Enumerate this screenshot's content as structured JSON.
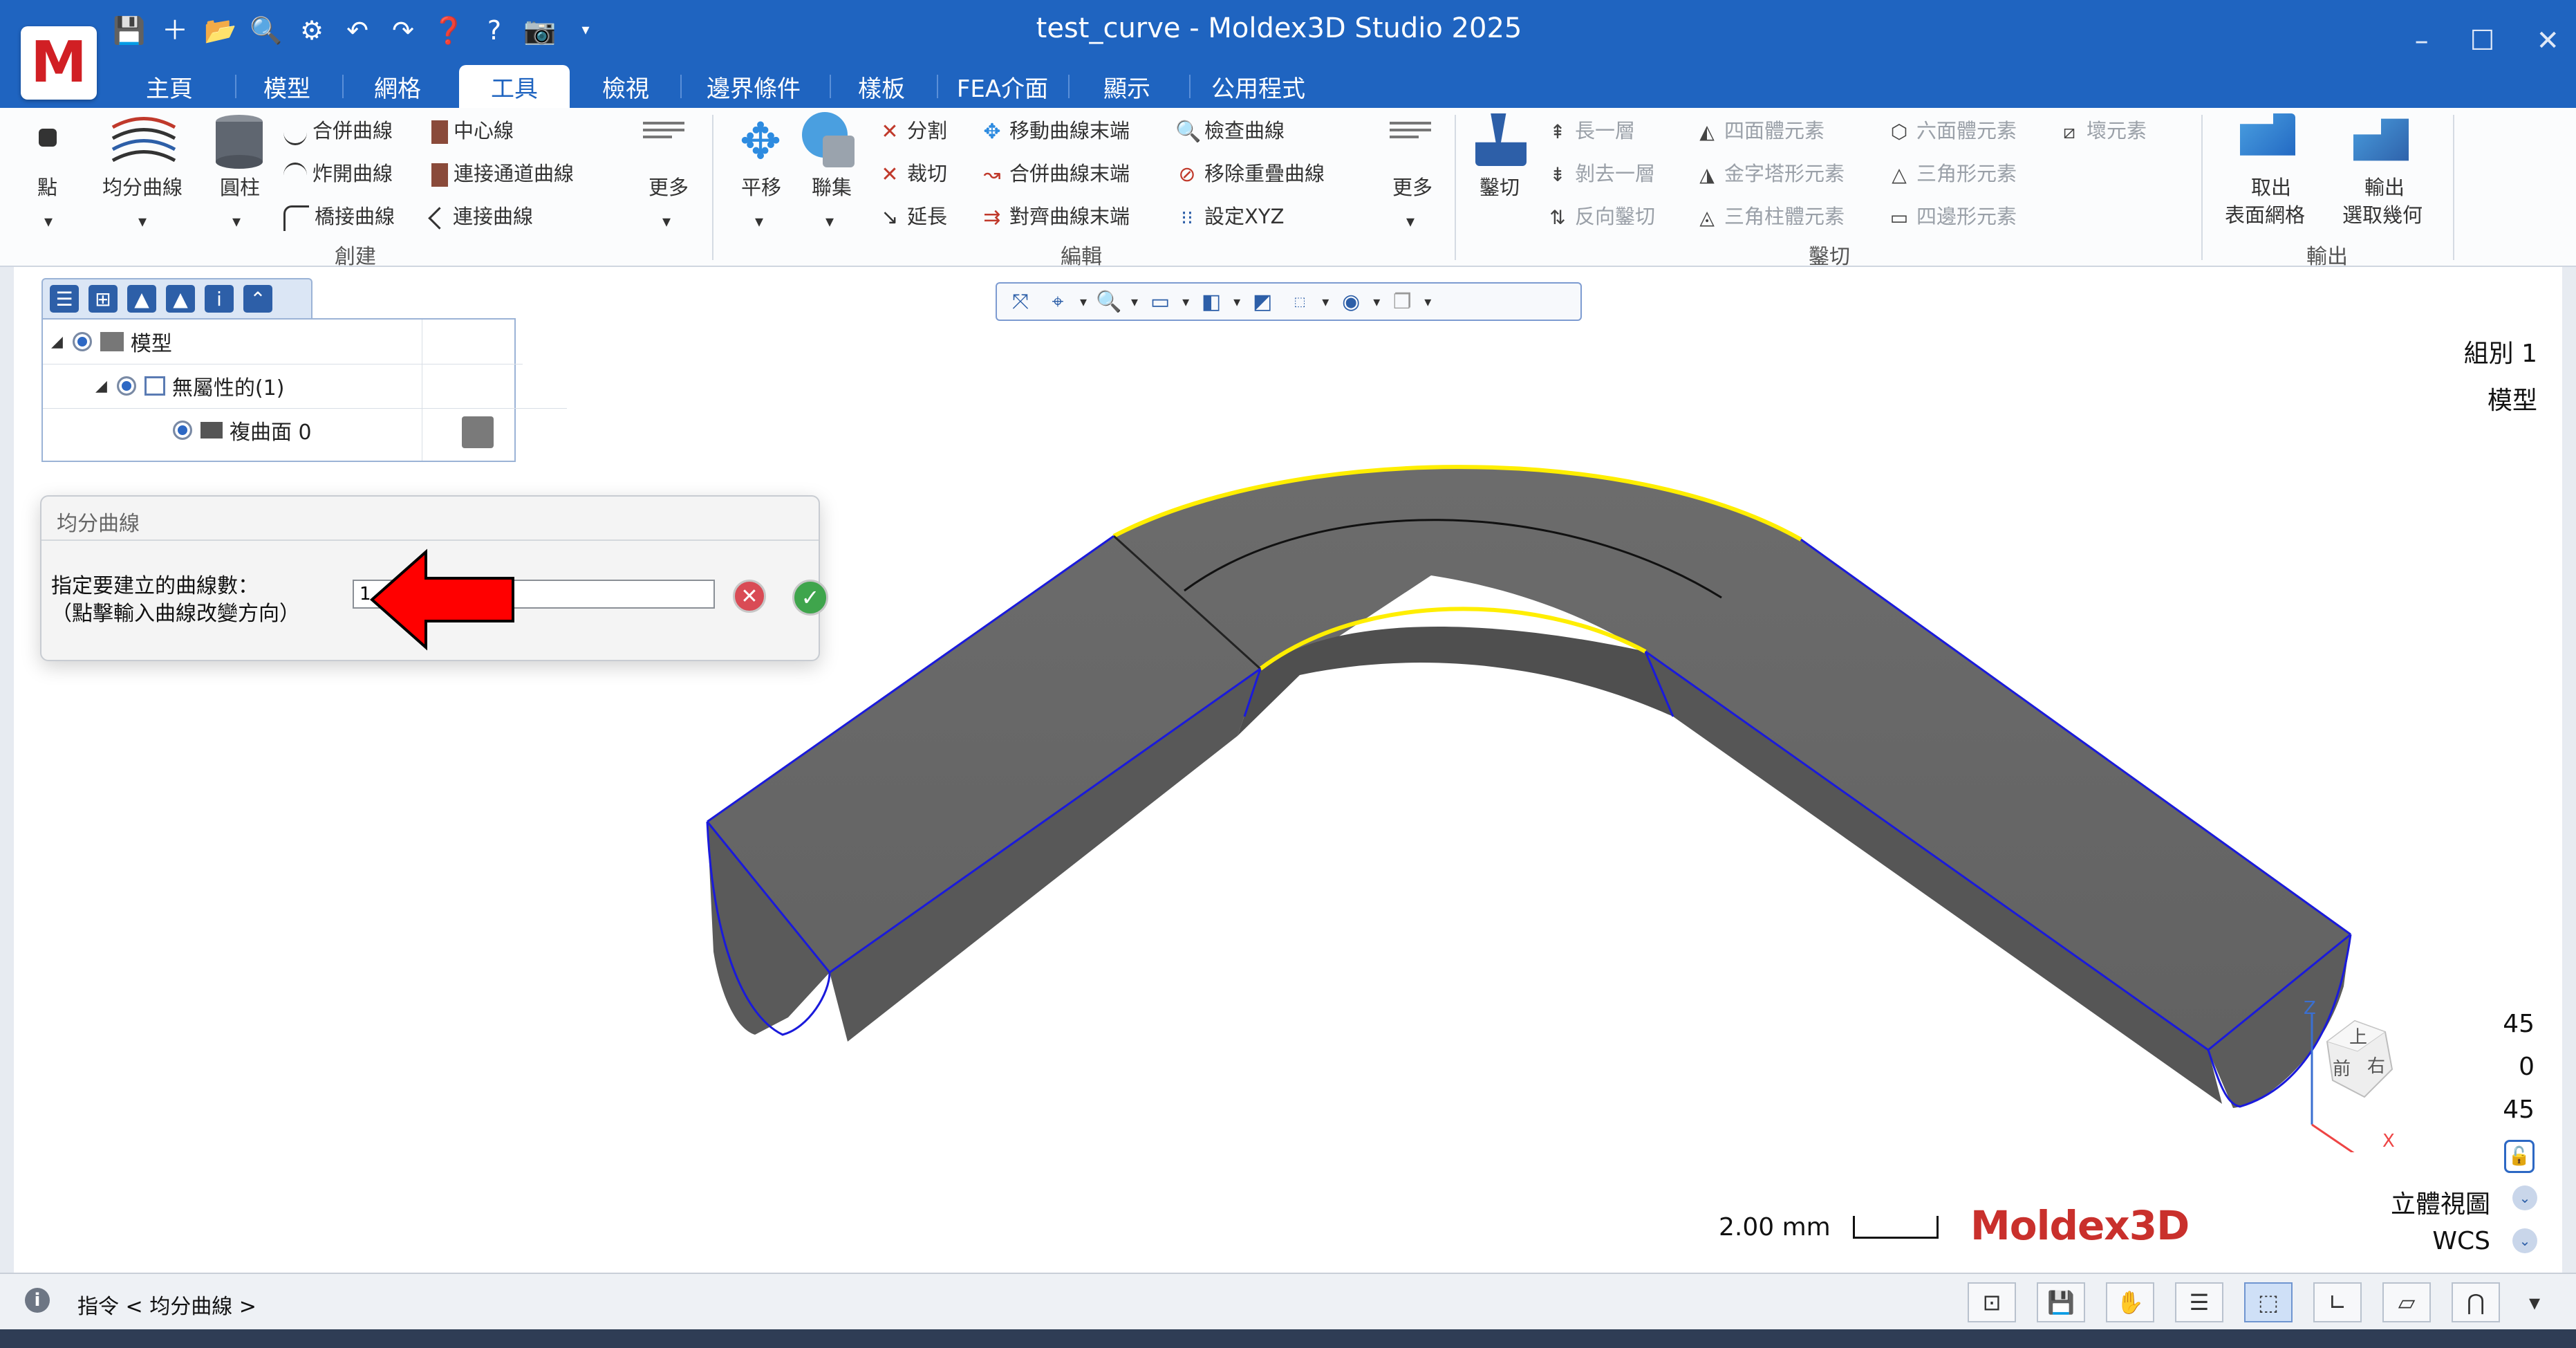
{
  "window": {
    "title": "test_curve - Moldex3D Studio 2025",
    "logo_letter": "M",
    "controls": [
      "–",
      "☐",
      "✕"
    ]
  },
  "quick_access": [
    "save-icon",
    "new-icon",
    "open-folder-icon",
    "search-file-icon",
    "settings-gear-icon",
    "undo-icon",
    "redo-icon",
    "help-doc-icon",
    "help-icon",
    "camera-icon",
    "dropdown-icon"
  ],
  "tabs": [
    "主頁",
    "模型",
    "網格",
    "工具",
    "檢視",
    "邊界條件",
    "樣板",
    "FEA介面",
    "顯示",
    "公用程式"
  ],
  "active_tab": "工具",
  "ribbon": {
    "create": {
      "group": "創建",
      "point": "點",
      "divide_curve": "均分曲線",
      "cylinder": "圓柱",
      "merge_curve": "合併曲線",
      "explode_curve": "炸開曲線",
      "bridge_curve": "橋接曲線",
      "centerline": "中心線",
      "connect_channel": "連接通道曲線",
      "connect_curve": "連接曲線",
      "more": "更多"
    },
    "edit": {
      "group": "編輯",
      "translate": "平移",
      "union": "聯集",
      "split": "分割",
      "trim": "裁切",
      "extend": "延長",
      "move_curve_end": "移動曲線末端",
      "merge_curve_end": "合併曲線末端",
      "align_curve_end": "對齊曲線末端",
      "check_curve": "檢查曲線",
      "remove_overlap": "移除重疊曲線",
      "set_xyz": "設定XYZ",
      "more": "更多"
    },
    "cut": {
      "group": "鑿切",
      "cut": "鑿切",
      "grow_layer": "長一層",
      "peel_layer": "剝去一層",
      "reverse_cut": "反向鑿切",
      "tetra": "四面體元素",
      "pyramid": "金字塔形元素",
      "prism": "三角柱體元素",
      "hexa": "六面體元素",
      "triangle": "三角形元素",
      "quad": "四邊形元素",
      "bad_elem": "壞元素"
    },
    "output": {
      "group": "輸出",
      "take_mesh_1": "取出",
      "take_mesh_2": "表面網格",
      "export_geo_1": "輸出",
      "export_geo_2": "選取幾何"
    }
  },
  "tree": {
    "root": "模型",
    "child": "無屬性的(1)",
    "leaf": "複曲面 0"
  },
  "dialog": {
    "title": "均分曲線",
    "label_line1": "指定要建立的曲線數：",
    "label_line2": "（點擊輸入曲線改變方向）",
    "input_value": "1",
    "cancel_symbol": "✕",
    "ok_symbol": "✓"
  },
  "view_labels": {
    "group": "組別 1",
    "model": "模型",
    "angle1": "45",
    "angle2": "0",
    "angle3": "45",
    "view_mode": "立體視圖",
    "coord": "WCS",
    "cube_top": "上",
    "cube_front": "前",
    "cube_right": "右",
    "axis_z": "Z",
    "axis_x": "X"
  },
  "scale": {
    "text": "2.00 mm"
  },
  "brand": "Moldex3D",
  "status": {
    "text": "指令 < 均分曲線 >"
  },
  "colors": {
    "brand_blue": "#1f64c0",
    "highlight_yellow": "#ffee00",
    "model_gray": "#686868",
    "edge_blue": "#1a1adb",
    "arrow_red": "#ff0000"
  }
}
